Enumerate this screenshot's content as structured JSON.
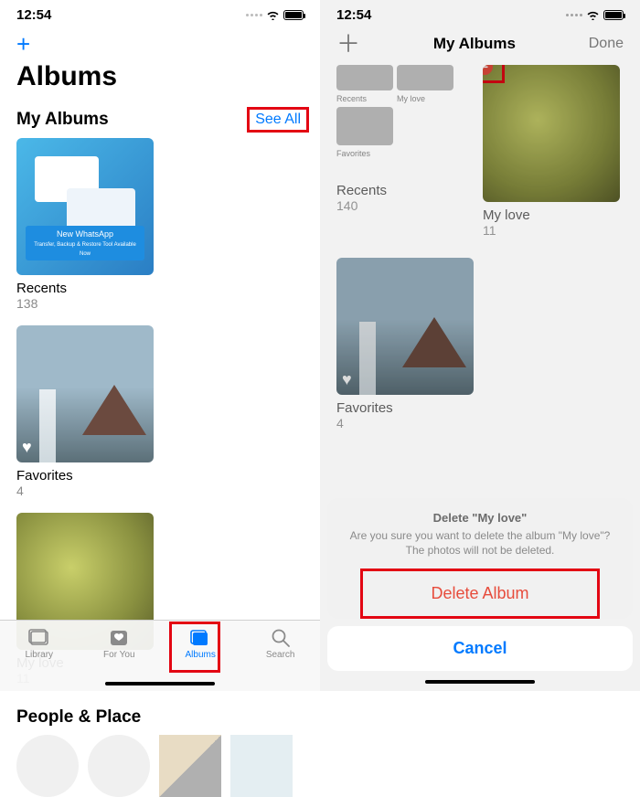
{
  "left": {
    "status_time": "12:54",
    "add_label": "+",
    "page_title": "Albums",
    "my_albums": {
      "heading": "My Albums",
      "see_all": "See All"
    },
    "albums": [
      {
        "title": "Recents",
        "count": "138"
      },
      {
        "title": "Favorites",
        "count": "4"
      },
      {
        "title": "My love",
        "count": "11"
      }
    ],
    "section_people": "People & Place",
    "tabs": {
      "library": "Library",
      "for_you": "For You",
      "albums": "Albums",
      "search": "Search"
    }
  },
  "right": {
    "status_time": "12:54",
    "nav_title": "My Albums",
    "done": "Done",
    "stack": [
      {
        "label": "Recents"
      },
      {
        "label": "My love"
      },
      {
        "label": "Favorites"
      }
    ],
    "albums": [
      {
        "title": "Recents",
        "count": "140"
      },
      {
        "title": "My love",
        "count": "11"
      },
      {
        "title": "Favorites",
        "count": "4"
      }
    ],
    "sheet": {
      "title": "Delete \"My love\"",
      "message": "Are you sure you want to delete the album \"My love\"? The photos will not be deleted.",
      "delete": "Delete Album",
      "cancel": "Cancel"
    }
  }
}
